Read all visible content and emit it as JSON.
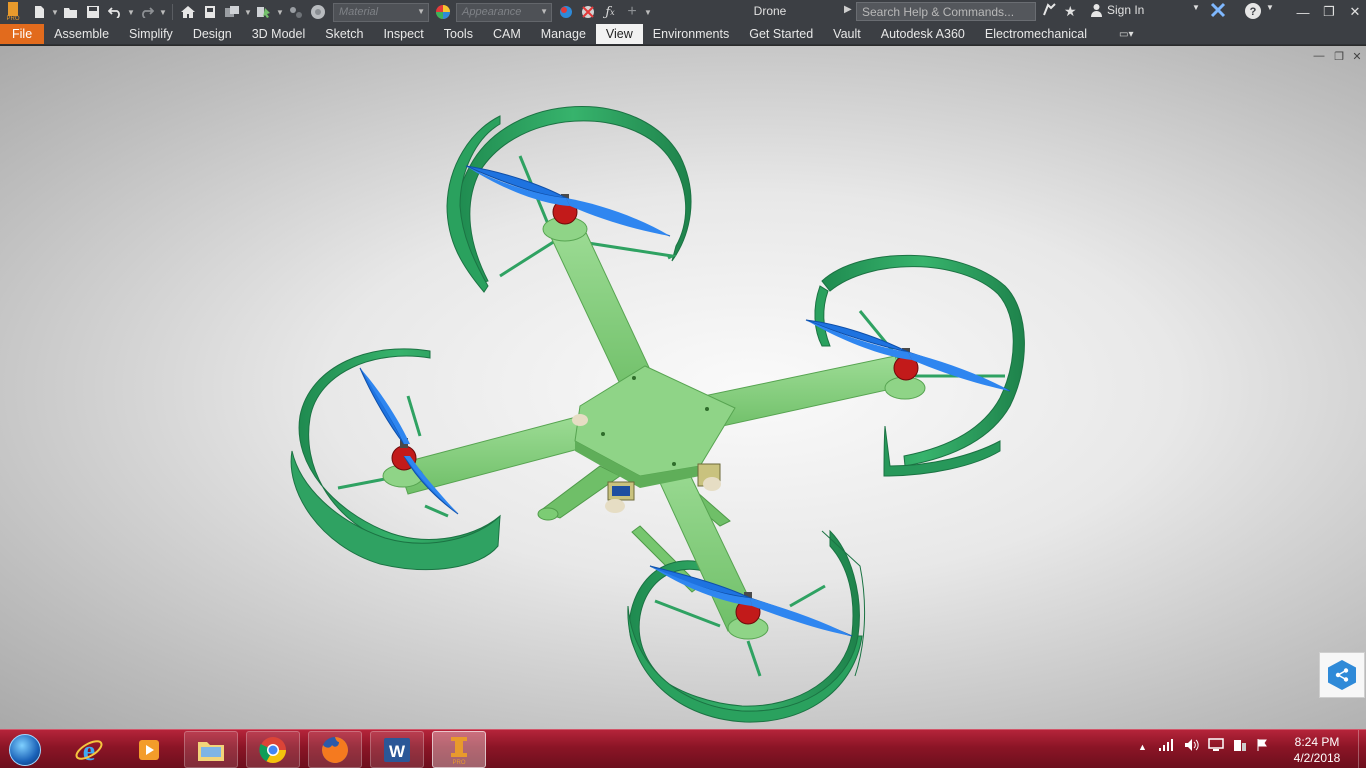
{
  "app": {
    "document_title": "Drone",
    "search_placeholder": "Search Help & Commands...",
    "sign_in": "Sign In",
    "material_placeholder": "Material",
    "appearance_placeholder": "Appearance",
    "logo_badge": "PRO"
  },
  "ribbon": {
    "tabs": [
      "File",
      "Assemble",
      "Simplify",
      "Design",
      "3D Model",
      "Sketch",
      "Inspect",
      "Tools",
      "CAM",
      "Manage",
      "View",
      "Environments",
      "Get Started",
      "Vault",
      "Autodesk A360",
      "Electromechanical"
    ],
    "active_tab": "View"
  },
  "colors": {
    "file_tab": "#e26b1d",
    "duct_green": "#2fa262",
    "frame_green": "#86d07f",
    "propeller_blue": "#1e73e0",
    "motor_red": "#c21a1a",
    "share_blue": "#2f8ad8"
  },
  "icons": [
    "new-icon",
    "open-icon",
    "save-icon",
    "undo-icon",
    "redo-icon",
    "home-icon",
    "properties-icon",
    "update-icon",
    "measure-icon",
    "color-wheel-icon",
    "fx-icon",
    "plus-icon",
    "help-icon",
    "share-icon"
  ],
  "taskbar": {
    "apps": [
      "Internet Explorer",
      "Media Player",
      "File Explorer",
      "Google Chrome",
      "Firefox",
      "Word",
      "Inventor Pro"
    ],
    "time": "8:24 PM",
    "date": "4/2/2018"
  }
}
